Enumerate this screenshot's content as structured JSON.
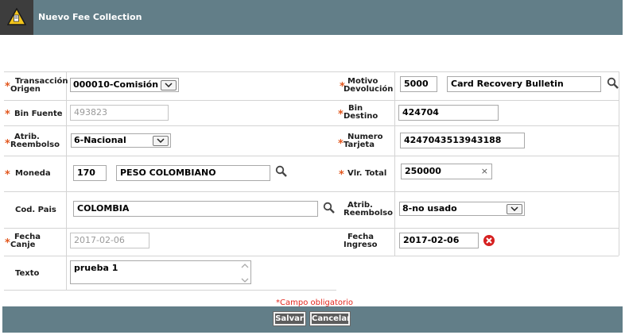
{
  "window": {
    "title": "Nuevo Fee Collection",
    "icon": "warning-icon"
  },
  "colors": {
    "header": "#627e88",
    "required_star": "#e2571e",
    "required_text": "#e2271e",
    "button": "#5c5c5c"
  },
  "form": {
    "transaccion_origen": {
      "label_1": "Transacción",
      "label_2": "Origen",
      "value": "000010-Comisión"
    },
    "motivo_devolucion": {
      "label_1": "Motivo",
      "label_2": "Devolución",
      "code": "5000",
      "description": "Card Recovery Bulletin"
    },
    "bin_fuente": {
      "label": "Bin Fuente",
      "value": "493823"
    },
    "bin_destino": {
      "label_1": "Bin",
      "label_2": "Destino",
      "value": "424704"
    },
    "atrib_reembolso_1": {
      "label_1": "Atrib.",
      "label_2": "Reembolso",
      "value": "6-Nacional"
    },
    "numero_tarjeta": {
      "label_1": "Numero",
      "label_2": "Tarjeta",
      "value": "4247043513943188"
    },
    "moneda": {
      "label": "Moneda",
      "code": "170",
      "description": "PESO COLOMBIANO"
    },
    "vlr_total": {
      "label": "Vlr. Total",
      "value": "250000",
      "clear": "×"
    },
    "cod_pais": {
      "label": "Cod. Pais",
      "value": "COLOMBIA"
    },
    "atrib_reembolso_2": {
      "label_1": "Atrib.",
      "label_2": "Reembolso",
      "value": "8-no usado"
    },
    "fecha_canje": {
      "label_1": "Fecha",
      "label_2": "Canje",
      "value": "2017-02-06"
    },
    "fecha_ingreso": {
      "label_1": "Fecha",
      "label_2": "Ingreso",
      "value": "2017-02-06"
    },
    "texto": {
      "label": "Texto",
      "value": "prueba 1"
    }
  },
  "footer": {
    "required_note": "*Campo obligatorio",
    "save_label": "Salvar",
    "cancel_label": "Cancelar"
  },
  "required_mark": "*"
}
